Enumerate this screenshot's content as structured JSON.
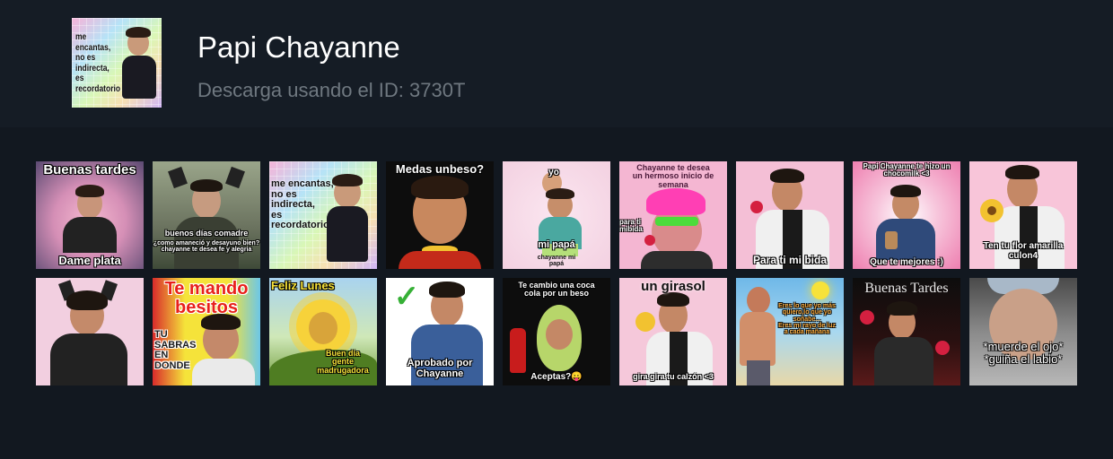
{
  "pack": {
    "title": "Papi Chayanne",
    "subtitle": "Descarga usando el ID: 3730T",
    "thumbnail_text": "me encantas,\nno es indirecta,\nes recordatorio"
  },
  "stickers": {
    "s1": {
      "top": "Buenas tardes",
      "bottom": "Dame plata"
    },
    "s2": {
      "line1": "buenos días comadre",
      "line2": "¿como amaneció y desayuno bien?\nchayanne te desea fe y alegria"
    },
    "s3": {
      "text": "me encantas,\nno es indirecta,\nes recordatorio"
    },
    "s4": {
      "top": "Medas unbeso?"
    },
    "s5": {
      "yo": "yo",
      "papa": "mi papá",
      "bottom": "chayanne mi\npapá"
    },
    "s6": {
      "top": "Chayanne te desea\nun hermoso inicio de\nsemana",
      "side": "para ti\nmibida"
    },
    "s7": {
      "bottom": "Para ti mi bida"
    },
    "s8": {
      "top": "Papi Chayanne te hizo un\nchocomilk <3",
      "bottom": "Que te mejores :)"
    },
    "s9": {
      "bottom": "Ten tu flor amarilla\nculon4"
    },
    "s10": {},
    "s11": {
      "top": "Te mando\nbesitos",
      "bottom": "TU\nSABRAS\nEN\nDONDE"
    },
    "s12": {
      "top": "Feliz Lunes",
      "bottom": "Buen dia\ngente\nmadrugadora"
    },
    "s13": {
      "check": "✓",
      "bottom": "Aprobado por\nChayanne"
    },
    "s14": {
      "top": "Te cambio una coca\ncola por un beso",
      "bottom": "Aceptas?😛"
    },
    "s15": {
      "top": "un girasol",
      "bottom": "gira gira tu calzón <3"
    },
    "s16": {
      "top": "Eres lo que yo más\nquiero,lo que yo\nsoñabe...\nEres mi rayo de luz\na cada mañana"
    },
    "s17": {
      "top": "Buenas Tardes"
    },
    "s18": {
      "bottom": "*muerde el ojo*\n*guiña el labio*"
    }
  },
  "colors": {
    "page_bg": "#121820",
    "header_bg": "#151c25",
    "title": "#ffffff",
    "subtitle": "#6f7880"
  }
}
